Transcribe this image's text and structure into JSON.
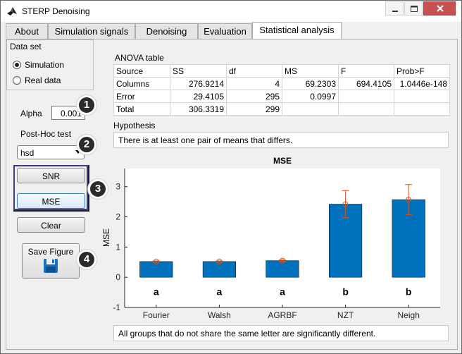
{
  "window": {
    "title": "STERP Denoising"
  },
  "tabs": [
    {
      "label": "About"
    },
    {
      "label": "Simulation signals"
    },
    {
      "label": "Denoising"
    },
    {
      "label": "Evaluation"
    },
    {
      "label": "Statistical analysis",
      "active": true
    }
  ],
  "dataset": {
    "title": "Data set",
    "options": [
      {
        "label": "Simulation",
        "selected": true
      },
      {
        "label": "Real data",
        "selected": false
      }
    ]
  },
  "alpha": {
    "label": "Alpha",
    "value": "0.001"
  },
  "posthoc": {
    "label": "Post-Hoc test",
    "value": "hsd"
  },
  "buttons": {
    "snr": "SNR",
    "mse": "MSE",
    "clear": "Clear",
    "save_figure": "Save Figure"
  },
  "badges": [
    "1",
    "2",
    "3",
    "4"
  ],
  "anova": {
    "title": "ANOVA table",
    "headers": [
      "Source",
      "SS",
      "df",
      "MS",
      "F",
      "Prob>F"
    ],
    "rows": [
      [
        "Columns",
        "276.9214",
        "4",
        "69.2303",
        "694.4105",
        "1.0446e-148"
      ],
      [
        "Error",
        "29.4105",
        "295",
        "0.0997",
        "",
        ""
      ],
      [
        "Total",
        "306.3319",
        "299",
        "",
        "",
        ""
      ]
    ]
  },
  "hypothesis": {
    "label": "Hypothesis",
    "text": "There is at least one pair of means that differs."
  },
  "note": "All groups that do not share the same letter are significantly different.",
  "colors": {
    "bar": "#0072bd",
    "error_bar": "#d95319",
    "titlebar_close": "#c75050",
    "badge": "#2a2a2a"
  },
  "chart_data": {
    "type": "bar",
    "title": "MSE",
    "ylabel": "MSE",
    "xlabel": "",
    "categories": [
      "Fourier",
      "Walsh",
      "AGRBF",
      "NZT",
      "Neigh"
    ],
    "values": [
      0.52,
      0.52,
      0.55,
      2.42,
      2.57
    ],
    "error": [
      0.02,
      0.02,
      0.02,
      0.45,
      0.5
    ],
    "group_letters": [
      "a",
      "a",
      "a",
      "b",
      "b"
    ],
    "ylim": [
      -1,
      3.6
    ],
    "yticks": [
      "-1",
      "0",
      "1",
      "2",
      "3"
    ],
    "grid": false
  }
}
